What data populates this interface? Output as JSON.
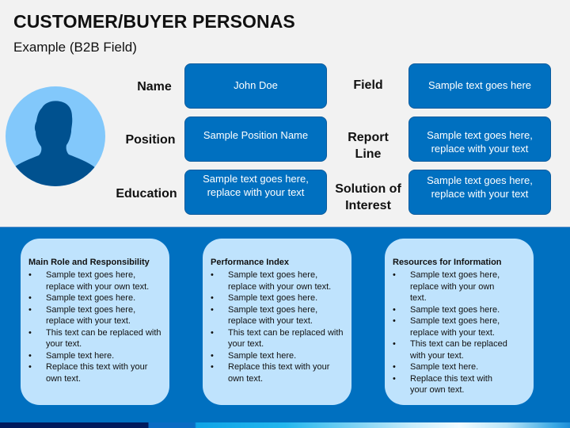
{
  "header": {
    "title": "CUSTOMER/BUYER PERSONAS",
    "subtitle": "Example (B2B Field)"
  },
  "avatar": {
    "icon": "person-silhouette-icon",
    "circle_color": "#82c8fb",
    "silhouette_color": "#00518f"
  },
  "fields": {
    "name": {
      "label": "Name",
      "value": "John Doe"
    },
    "position": {
      "label": "Position",
      "value": "Sample Position Name"
    },
    "education": {
      "label": "Education",
      "value_line1": "Sample text goes here,",
      "value_line2": "replace with your text"
    },
    "field": {
      "label": "Field",
      "value": "Sample text goes here"
    },
    "report_line": {
      "label_line1": "Report",
      "label_line2": "Line",
      "value_line1": "Sample text goes here,",
      "value_line2": "replace with your text"
    },
    "solution_of_interest": {
      "label_line1": "Solution of",
      "label_line2": "Interest",
      "value_line1": "Sample text goes here,",
      "value_line2": "replace with your text"
    }
  },
  "cards": [
    {
      "title": "Main Role and Responsibility",
      "items": [
        "Sample text goes here, replace with your own text.",
        "Sample text goes here.",
        "Sample text goes here, replace with your text.",
        "This text can be replaced with your text.",
        "Sample text here.",
        "Replace this text with your own text."
      ]
    },
    {
      "title": "Performance Index",
      "items": [
        "Sample text goes here, replace with your own text.",
        "Sample text goes here.",
        "Sample text goes here, replace with your text.",
        "This text can be replaced with your text.",
        "Sample text here.",
        "Replace this text with your own text."
      ]
    },
    {
      "title": "Resources for Information",
      "items": [
        "Sample text goes here, replace with your own text.",
        "Sample text goes here.",
        "Sample text goes here, replace with your text.",
        "This text can be replaced with your text.",
        "Sample text here.",
        "Replace this text with your own text."
      ]
    }
  ],
  "bullet_glyph": "•",
  "colors": {
    "background": "#f2f2f2",
    "box_blue": "#0070c0",
    "card_fill": "#bfe3fd",
    "strip_dark": "#001a5c"
  }
}
